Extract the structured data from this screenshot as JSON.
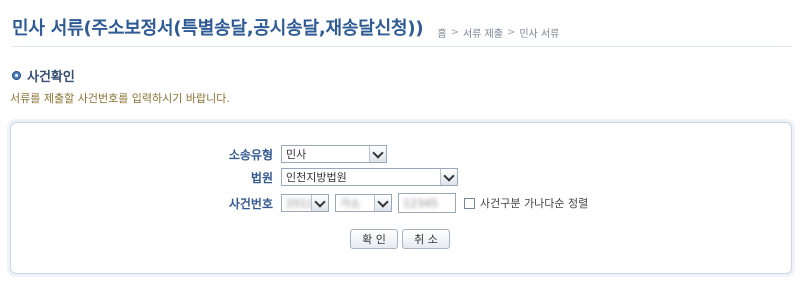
{
  "header": {
    "title": "민사 서류(주소보정서(특별송달,공시송달,재송달신청))",
    "breadcrumb": [
      "홈",
      "서류 제출",
      "민사 서류"
    ],
    "breadcrumb_sep": ">"
  },
  "section": {
    "title": "사건확인"
  },
  "instruction": "서류를 제출할 사건번호를 입력하시기 바랍니다.",
  "form": {
    "case_type": {
      "label": "소송유형",
      "value": "민사"
    },
    "court": {
      "label": "법원",
      "value": "인천지방법원"
    },
    "case_number": {
      "label": "사건번호",
      "year": "2012",
      "kind": "가소",
      "number": "12345"
    },
    "sort_option": {
      "label": "사건구분 가나다순 정렬",
      "checked": false
    }
  },
  "buttons": {
    "confirm": "확 인",
    "cancel": "취 소"
  },
  "colors": {
    "title": "#2f5b95",
    "label": "#355a92",
    "instruction": "#8a7434",
    "panel_border": "#c9d6e6"
  }
}
